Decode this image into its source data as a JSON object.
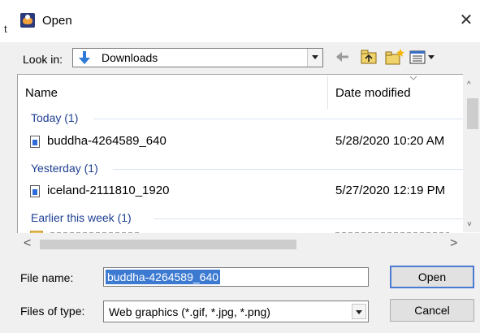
{
  "window": {
    "title": "Open",
    "close_glyph": "✕",
    "background_fragment": "t"
  },
  "toolbar": {
    "look_in_label": "Look in:",
    "look_in_value": "Downloads",
    "look_in_icon": "download-folder-icon",
    "buttons": [
      "back-arrow-icon",
      "up-one-level-icon",
      "new-folder-icon",
      "view-menu-icon"
    ]
  },
  "file_list": {
    "columns": [
      "Name",
      "Date modified"
    ],
    "groups": [
      {
        "label": "Today (1)",
        "items": [
          {
            "name": "buddha-4264589_640",
            "date": "5/28/2020 10:20 AM",
            "icon": "image-file-icon"
          }
        ]
      },
      {
        "label": "Yesterday (1)",
        "items": [
          {
            "name": "iceland-2111810_1920",
            "date": "5/27/2020 12:19 PM",
            "icon": "image-file-icon"
          }
        ]
      },
      {
        "label": "Earlier this week (1)",
        "items": []
      }
    ]
  },
  "scrollbars": {
    "up_glyph": "^",
    "down_glyph": "˅",
    "left_glyph": "<",
    "right_glyph": ">"
  },
  "form": {
    "file_name_label": "File name:",
    "file_name_value": "buddha-4264589_640",
    "file_type_label": "Files of type:",
    "file_type_value": "Web graphics (*.gif, *.jpg, *.png)"
  },
  "buttons": {
    "open_label": "Open",
    "cancel_label": "Cancel"
  },
  "colors": {
    "group_header": "#1e3f93",
    "selection": "#3c7ad2",
    "default_button_border": "#4a7bd0"
  }
}
